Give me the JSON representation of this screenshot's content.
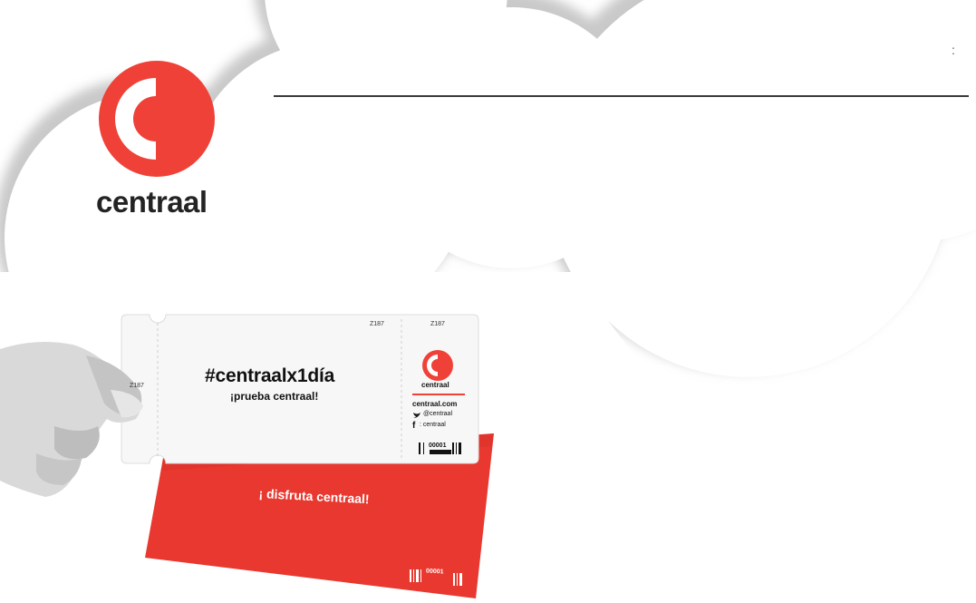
{
  "brand": {
    "name": "centraal",
    "accent_color": "#EF4137",
    "text_color": "#232323"
  },
  "ticket": {
    "hashtag": "#centraalx1día",
    "subtitle": "¡prueba centraal!",
    "code": "Z187",
    "mini_brand": "centraal",
    "website": "centraal.com",
    "twitter": "@centraal",
    "facebook": ": centraal",
    "serial": "00001"
  },
  "back_ticket": {
    "slogan": "¡ disfruta centraal!",
    "serial": "00001",
    "color": "#E8382F"
  },
  "icons": {
    "logo": "centraal-c-logo-icon",
    "twitter": "twitter-bird-icon",
    "facebook": "facebook-f-icon",
    "barcode": "barcode-icon"
  }
}
